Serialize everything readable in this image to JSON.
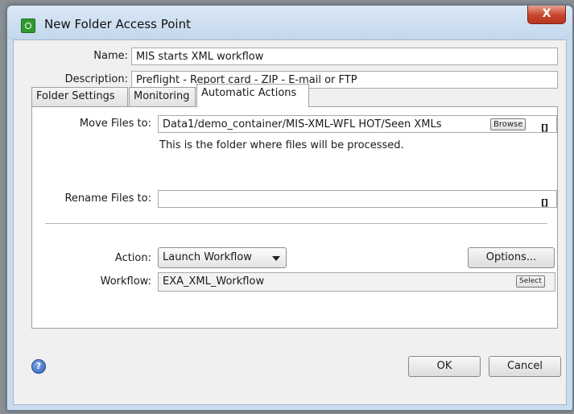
{
  "window": {
    "title": "New Folder Access Point",
    "close_label": "X"
  },
  "general": {
    "name_label": "Name:",
    "name_value": "MIS starts XML workflow",
    "description_label": "Description:",
    "description_value": "Preflight - Report card - ZIP - E-mail or FTP"
  },
  "tabs": [
    {
      "label": "Folder Settings",
      "active": false
    },
    {
      "label": "Monitoring",
      "active": false
    },
    {
      "label": "Automatic Actions",
      "active": true
    }
  ],
  "automatic_actions": {
    "move_label": "Move Files to:",
    "move_value": "Data1/demo_container/MIS-XML-WFL HOT/Seen XMLs",
    "browse_label": "Browse",
    "move_var_icon": "[]",
    "move_hint": "This is the folder where files will be processed.",
    "rename_label": "Rename Files to:",
    "rename_value": "",
    "rename_var_icon": "[]",
    "action_label": "Action:",
    "action_value": "Launch Workflow",
    "options_label": "Options...",
    "workflow_label": "Workflow:",
    "workflow_value": "EXA_XML_Workflow",
    "select_label": "Select"
  },
  "footer": {
    "help_icon": "?",
    "ok_label": "OK",
    "cancel_label": "Cancel"
  },
  "colors": {
    "title_bar": "#c9dcef",
    "close_button": "#c7442b",
    "app_icon": "#2f9a2f",
    "help_icon": "#2c5fb8"
  }
}
